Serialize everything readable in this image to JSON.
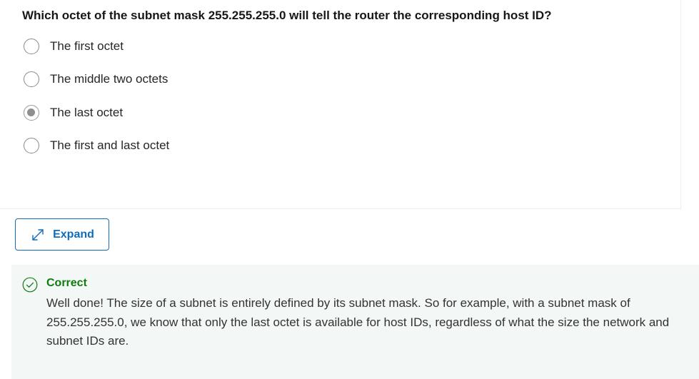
{
  "question": {
    "text": "Which octet of the subnet mask 255.255.255.0 will tell the router the corresponding host ID?",
    "options": [
      {
        "label": "The first octet",
        "selected": false
      },
      {
        "label": "The middle two octets",
        "selected": false
      },
      {
        "label": "The last octet",
        "selected": true
      },
      {
        "label": "The first and last octet",
        "selected": false
      }
    ]
  },
  "expand_button": {
    "label": "Expand",
    "icon": "expand-arrows-icon"
  },
  "feedback": {
    "status": "Correct",
    "icon": "check-circle-icon",
    "message": "Well done! The size of a subnet is entirely defined by its subnet mask. So for example, with a subnet mask of 255.255.255.0, we know that only the last octet is available for host IDs, regardless of what the size the network and subnet IDs are."
  },
  "colors": {
    "accent": "#0f6cbd",
    "success": "#107c10",
    "feedback_background": "#f3f7f5"
  }
}
